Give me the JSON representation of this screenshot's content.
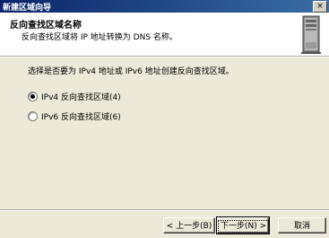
{
  "window": {
    "title": "新建区域向导",
    "close_glyph": "×"
  },
  "header": {
    "title": "反向查找区域名称",
    "subtitle": "反向查找区域将 IP 地址转换为 DNS 名称。",
    "icon": "server-icon"
  },
  "body": {
    "question": "选择是否要为 IPv4 地址或 IPv6 地址创建反向查找区域。",
    "options": [
      {
        "label": "IPv4 反向查找区域(4)",
        "checked": true
      },
      {
        "label": "IPv6 反向查找区域(6)",
        "checked": false
      }
    ]
  },
  "buttons": {
    "back": "< 上一步(B)",
    "next": "下一步(N) >",
    "cancel": "取消"
  }
}
